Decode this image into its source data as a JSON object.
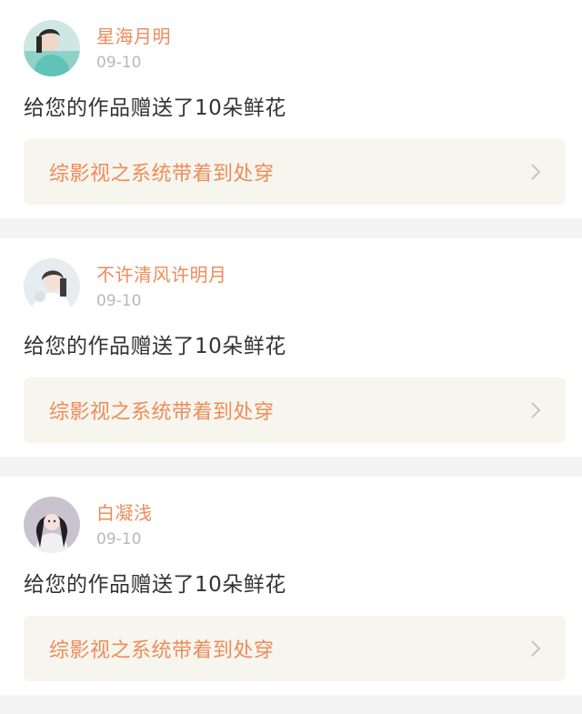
{
  "colors": {
    "accent": "#ef8b5a",
    "link_bg": "#f6f6ee",
    "text": "#333333",
    "muted": "#b8b8b8",
    "separator": "#f4f4f4"
  },
  "notifications": [
    {
      "username": "星海月明",
      "date": "09-10",
      "message": "给您的作品赠送了10朵鲜花",
      "work_title": "综影视之系统带着到处穿",
      "avatar_icon": "user-avatar-icon"
    },
    {
      "username": "不许清风许明月",
      "date": "09-10",
      "message": "给您的作品赠送了10朵鲜花",
      "work_title": "综影视之系统带着到处穿",
      "avatar_icon": "user-avatar-icon"
    },
    {
      "username": "白凝浅",
      "date": "09-10",
      "message": "给您的作品赠送了10朵鲜花",
      "work_title": "综影视之系统带着到处穿",
      "avatar_icon": "user-avatar-icon"
    }
  ]
}
